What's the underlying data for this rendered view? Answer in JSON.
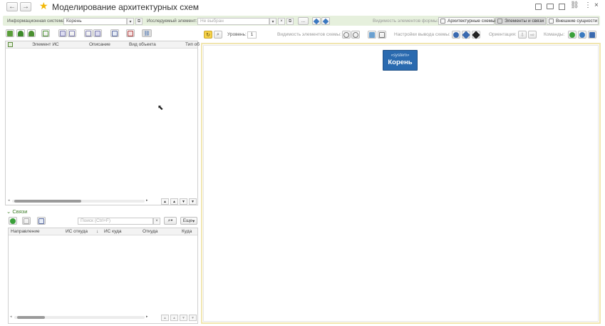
{
  "window": {
    "title": "Моделирование архитектурных схем",
    "back_icon": "arrow-left-icon",
    "forward_icon": "arrow-right-icon",
    "favorite_icon": "star-icon",
    "tool_icons": [
      "save-icon",
      "print-icon",
      "preview-icon",
      "link-icon",
      "more-icon",
      "close-icon"
    ]
  },
  "filters": {
    "info_system_label": "Информационная система:",
    "info_system_value": "Корень",
    "element_label": "Исследуемый элемент:",
    "element_placeholder": "Не выбран",
    "ellipsis": "...",
    "visibility_label": "Видимость элементов формы:",
    "modes": [
      "Архитектурные схемы",
      "Элементы и связи",
      "Внешние сущности"
    ],
    "active_mode": "Элементы и связи"
  },
  "scheme_toolbar": {
    "level_label": "Уровень:",
    "level_value": "1",
    "visibility_label": "Видимость элементов схемы:",
    "output_label": "Настройки вывода схемы:",
    "orientation_label": "Ориентация:",
    "commands_label": "Команды:"
  },
  "elements_table": {
    "columns": [
      "Элемент ИС",
      "Описание",
      "Вид объекта",
      "Тип об"
    ]
  },
  "links": {
    "section_title": "Связи",
    "search_placeholder": "Поиск (Ctrl+F)",
    "more_label": "Еще",
    "columns": [
      "Направление",
      "ИС откуда",
      "↓",
      "ИС куда",
      "Откуда",
      "Куда"
    ]
  },
  "diagram": {
    "node_stereotype": "«system»",
    "node_name": "Корень",
    "node_color": "#2a6aaf"
  }
}
